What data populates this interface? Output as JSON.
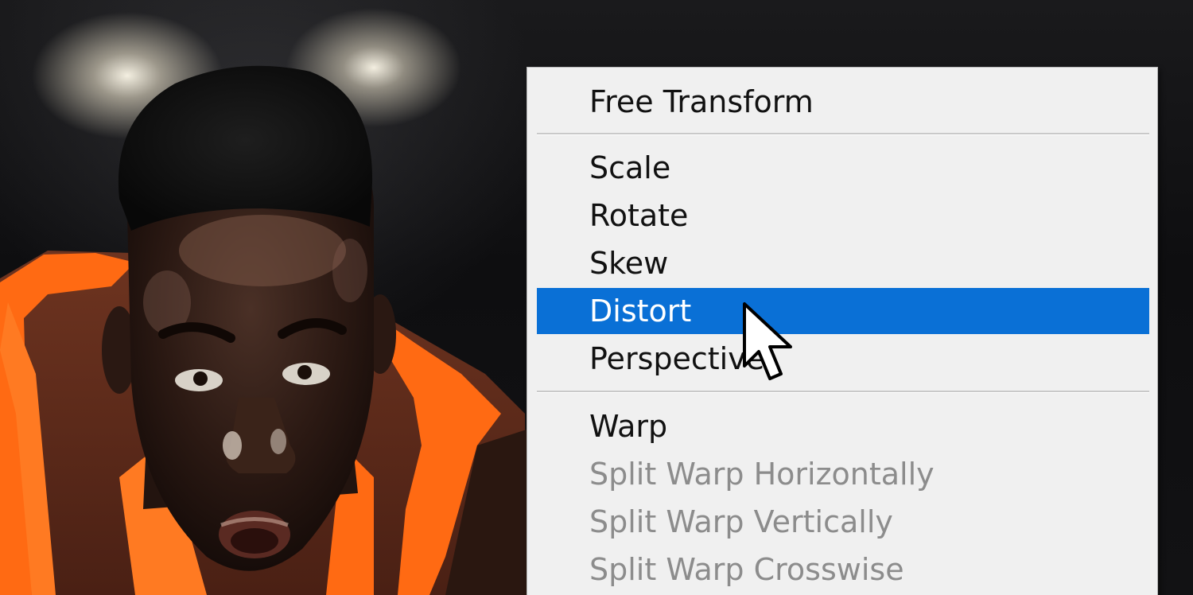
{
  "context_menu": {
    "items": [
      {
        "label": "Free Transform",
        "enabled": true
      },
      {
        "separator": true
      },
      {
        "label": "Scale",
        "enabled": true
      },
      {
        "label": "Rotate",
        "enabled": true
      },
      {
        "label": "Skew",
        "enabled": true
      },
      {
        "label": "Distort",
        "enabled": true,
        "highlighted": true
      },
      {
        "label": "Perspective",
        "enabled": true
      },
      {
        "separator": true
      },
      {
        "label": "Warp",
        "enabled": true
      },
      {
        "label": "Split Warp Horizontally",
        "enabled": false
      },
      {
        "label": "Split Warp Vertically",
        "enabled": false
      },
      {
        "label": "Split Warp Crosswise",
        "enabled": false
      }
    ]
  },
  "colors": {
    "highlight": "#0a70d6",
    "menu_background": "#f0f0f0",
    "disabled_text": "#8c8c8c",
    "jersey_orange": "#ff6a13"
  },
  "background_image": {
    "subject": "basketball player in orange jersey"
  },
  "cursor": {
    "icon": "arrow-pointer-icon"
  }
}
